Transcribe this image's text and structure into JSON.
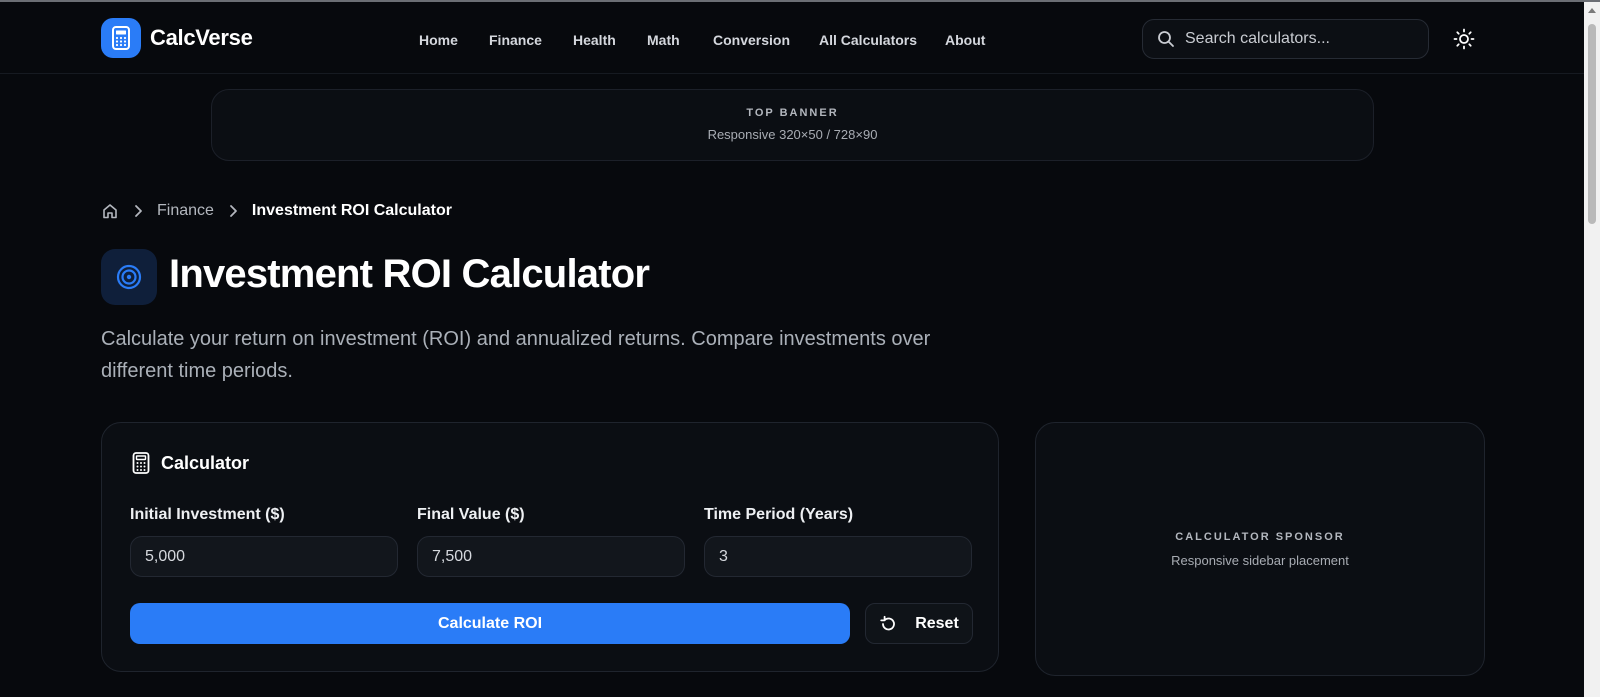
{
  "app": {
    "name": "CalcVerse",
    "accent": "#2a7cf7"
  },
  "nav": {
    "items": [
      {
        "label": "Home"
      },
      {
        "label": "Finance"
      },
      {
        "label": "Health"
      },
      {
        "label": "Math"
      },
      {
        "label": "Conversion"
      },
      {
        "label": "All Calculators"
      },
      {
        "label": "About"
      }
    ]
  },
  "search": {
    "placeholder": "Search calculators..."
  },
  "banner": {
    "title": "TOP BANNER",
    "subtitle": "Responsive 320×50 / 728×90"
  },
  "breadcrumb": {
    "parent": "Finance",
    "current": "Investment ROI Calculator"
  },
  "page": {
    "title": "Investment ROI Calculator",
    "description": "Calculate your return on investment (ROI) and annualized returns. Compare investments over different time periods."
  },
  "calculator": {
    "heading": "Calculator",
    "fields": [
      {
        "label": "Initial Investment ($)",
        "value": "5,000"
      },
      {
        "label": "Final Value ($)",
        "value": "7,500"
      },
      {
        "label": "Time Period (Years)",
        "value": "3"
      }
    ],
    "calculate_label": "Calculate ROI",
    "reset_label": "Reset"
  },
  "sponsor": {
    "title": "CALCULATOR SPONSOR",
    "subtitle": "Responsive sidebar placement"
  }
}
